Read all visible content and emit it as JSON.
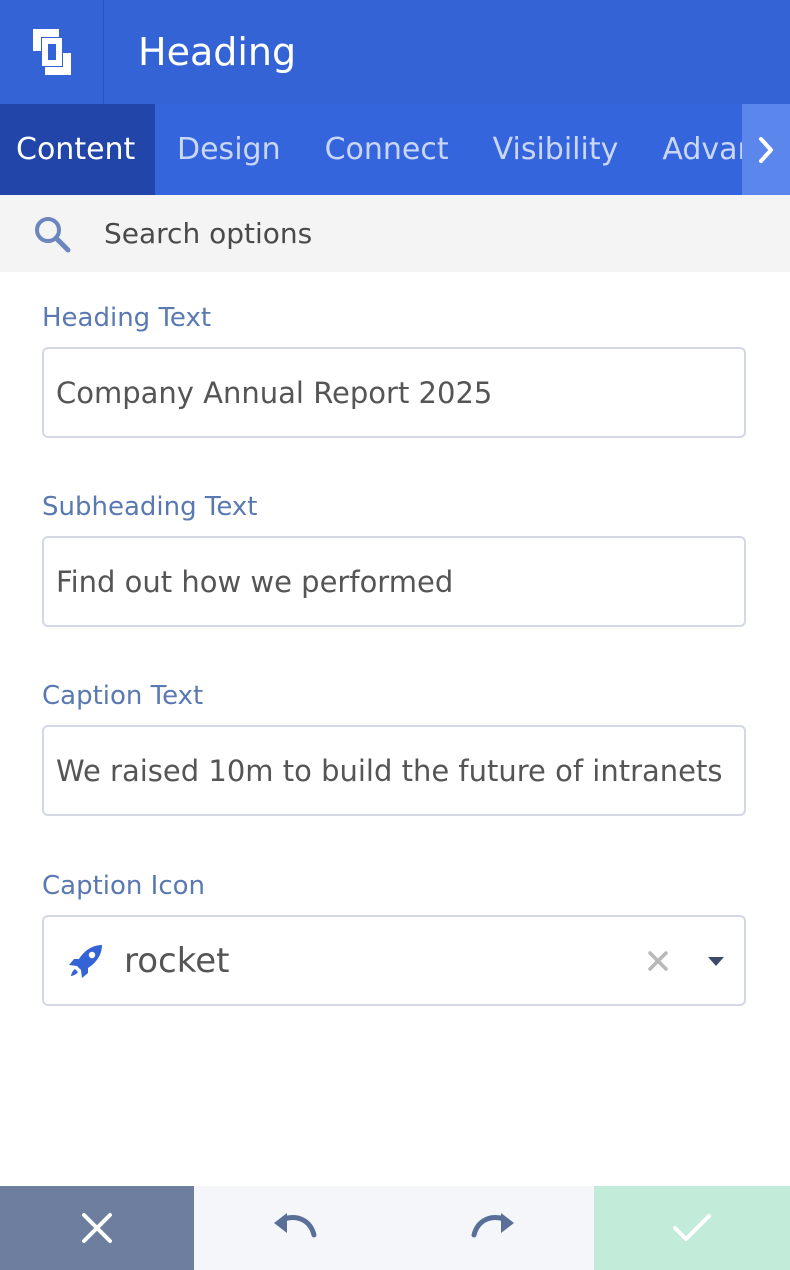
{
  "header": {
    "logo_icon": "brand-logo-icon",
    "title": "Heading"
  },
  "tabs": [
    {
      "label": "Content",
      "active": true
    },
    {
      "label": "Design",
      "active": false
    },
    {
      "label": "Connect",
      "active": false
    },
    {
      "label": "Visibility",
      "active": false
    },
    {
      "label": "Advan",
      "active": false
    }
  ],
  "tab_scroll_icon": "chevron-right-icon",
  "search": {
    "icon": "search-icon",
    "placeholder": "Search options"
  },
  "fields": {
    "heading": {
      "label": "Heading Text",
      "value": "Company Annual Report 2025"
    },
    "subheading": {
      "label": "Subheading Text",
      "value": "Find out how we performed"
    },
    "caption": {
      "label": "Caption Text",
      "value": "We raised 10m to build the future of intranets"
    },
    "caption_icon": {
      "label": "Caption Icon",
      "value": "rocket",
      "icon": "rocket-icon"
    }
  },
  "footer": {
    "cancel_icon": "close-icon",
    "undo_icon": "undo-icon",
    "redo_icon": "redo-icon",
    "save_icon": "check-icon"
  },
  "colors": {
    "header_bg": "#3463d6",
    "tab_active_bg": "#2145a8",
    "label_color": "#5a79b2",
    "cancel_bg": "#6e7e9e",
    "save_bg": "#c3ebd9"
  }
}
